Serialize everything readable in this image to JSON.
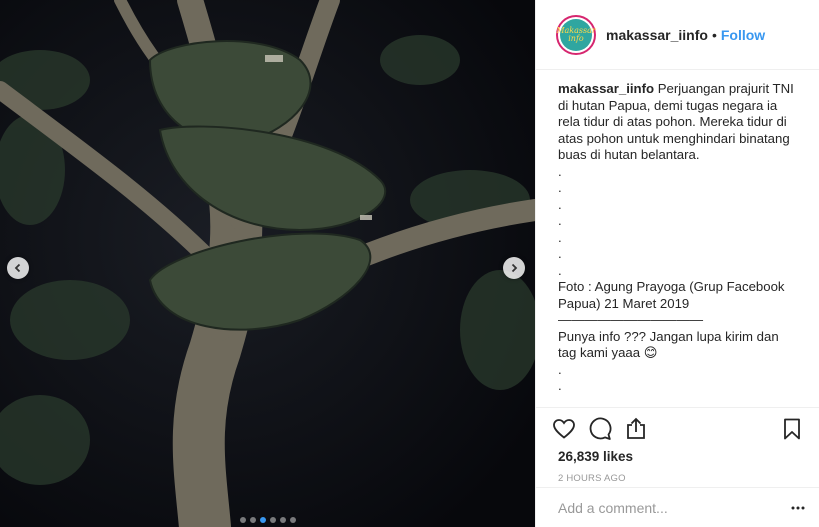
{
  "post": {
    "username": "makassar_iinfo",
    "separator": "•",
    "follow_label": "Follow",
    "avatar_text": "Makassar info",
    "caption": {
      "user": "makassar_iinfo",
      "text": "Perjuangan prajurit TNI di hutan Papua, demi tugas negara ia rela tidur di atas pohon. Mereka tidur di atas pohon untuk menghindari binatang buas di hutan belantara.",
      "dots": [
        ".",
        ".",
        ".",
        ".",
        ".",
        ".",
        "."
      ],
      "credit": "Foto : Agung Prayoga (Grup Facebook Papua) 21 Maret 2019",
      "divider": "———————————",
      "cta": "Punya info ??? Jangan lupa kirim dan tag kami yaaa 😊",
      "trailing_dots": [
        ".",
        "."
      ]
    },
    "likes": "26,839 likes",
    "time": "2 HOURS AGO",
    "comment_placeholder": "Add a comment...",
    "carousel": {
      "total": 6,
      "active": 2
    }
  },
  "colors": {
    "accent": "#3897f0",
    "text": "#262626",
    "muted": "#999999",
    "border": "#efefef"
  },
  "icons": {
    "like": "heart-icon",
    "comment": "comment-icon",
    "share": "share-icon",
    "save": "bookmark-icon",
    "more": "more-icon",
    "prev": "chevron-left-icon",
    "next": "chevron-right-icon"
  }
}
